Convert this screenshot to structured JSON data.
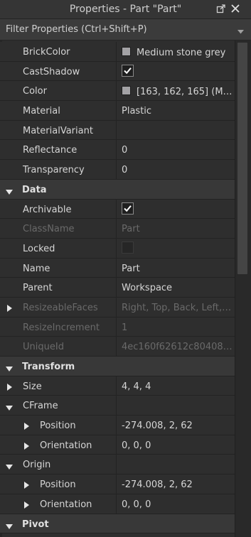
{
  "window": {
    "title": "Properties - Part \"Part\""
  },
  "filter": {
    "placeholder": "Filter Properties (Ctrl+Shift+P)"
  },
  "rows": [
    {
      "type": "prop",
      "name": "BrickColor",
      "value": "Medium stone grey",
      "swatch": "#a3a2a5"
    },
    {
      "type": "prop",
      "name": "CastShadow",
      "checkbox": true
    },
    {
      "type": "prop",
      "name": "Color",
      "value": "[163, 162, 165] (Me...",
      "swatch": "#a3a2a5"
    },
    {
      "type": "prop",
      "name": "Material",
      "value": "Plastic"
    },
    {
      "type": "prop",
      "name": "MaterialVariant",
      "value": ""
    },
    {
      "type": "prop",
      "name": "Reflectance",
      "value": "0"
    },
    {
      "type": "prop",
      "name": "Transparency",
      "value": "0"
    },
    {
      "type": "section",
      "name": "Data"
    },
    {
      "type": "prop",
      "name": "Archivable",
      "checkbox": true
    },
    {
      "type": "prop",
      "name": "ClassName",
      "value": "Part",
      "disabled": true
    },
    {
      "type": "prop",
      "name": "Locked",
      "checkbox": false
    },
    {
      "type": "prop",
      "name": "Name",
      "value": "Part"
    },
    {
      "type": "prop",
      "name": "Parent",
      "value": "Workspace"
    },
    {
      "type": "prop",
      "name": "ResizeableFaces",
      "value": "Right, Top, Back, Left, ...",
      "disabled": true,
      "expander": "collapsed"
    },
    {
      "type": "prop",
      "name": "ResizeIncrement",
      "value": "1",
      "disabled": true
    },
    {
      "type": "prop",
      "name": "UniqueId",
      "value": "4ec160f62612c80408a...",
      "disabled": true
    },
    {
      "type": "section",
      "name": "Transform"
    },
    {
      "type": "prop",
      "name": "Size",
      "value": "4, 4, 4",
      "expander": "collapsed"
    },
    {
      "type": "prop",
      "name": "CFrame",
      "value": "",
      "expander": "expanded"
    },
    {
      "type": "prop",
      "name": "Position",
      "value": "-274.008, 2, 62",
      "expander": "collapsed",
      "indent": 1
    },
    {
      "type": "prop",
      "name": "Orientation",
      "value": "0, 0, 0",
      "expander": "collapsed",
      "indent": 1
    },
    {
      "type": "prop",
      "name": "Origin",
      "value": "",
      "expander": "expanded"
    },
    {
      "type": "prop",
      "name": "Position",
      "value": "-274.008, 2, 62",
      "expander": "collapsed",
      "indent": 1
    },
    {
      "type": "prop",
      "name": "Orientation",
      "value": "0, 0, 0",
      "expander": "collapsed",
      "indent": 1
    },
    {
      "type": "section",
      "name": "Pivot"
    }
  ],
  "colors": {
    "background": "#2e2e2e",
    "section": "#383838",
    "text": "#d6d6d6",
    "disabled": "#6a6a6a",
    "grid": "#232323"
  },
  "icons": [
    "undock-icon",
    "close-icon",
    "chevron-down-icon",
    "triangle-right-icon",
    "triangle-down-icon",
    "checkmark-icon"
  ]
}
